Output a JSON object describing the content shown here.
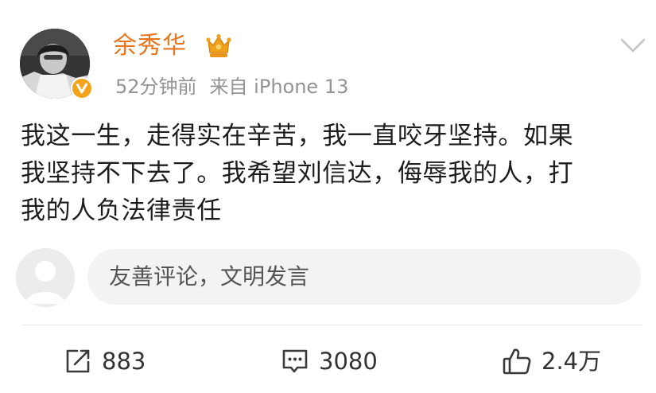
{
  "post": {
    "author": {
      "name": "余秀华",
      "avatar_icon": "avatar-photo",
      "verified_badge_icon": "verified-v-icon",
      "membership_icon": "vip-crown-icon",
      "name_color": "#e8761f"
    },
    "meta": {
      "time": "52分钟前",
      "source": "来自 iPhone 13"
    },
    "more_icon": "chevron-down-icon",
    "text_lines": [
      "我这一生，走得实在辛苦，我一直咬牙坚持。如果",
      "我坚持不下去了。我希望刘信达，侮辱我的人，打",
      "我的人负法律责任"
    ]
  },
  "comment_box": {
    "avatar_icon": "default-user-avatar",
    "placeholder": "友善评论，文明发言"
  },
  "actions": {
    "repost": {
      "icon": "share-icon",
      "count": "883"
    },
    "comment": {
      "icon": "comment-icon",
      "count": "3080"
    },
    "like": {
      "icon": "thumbs-up-icon",
      "count": "2.4万"
    }
  }
}
